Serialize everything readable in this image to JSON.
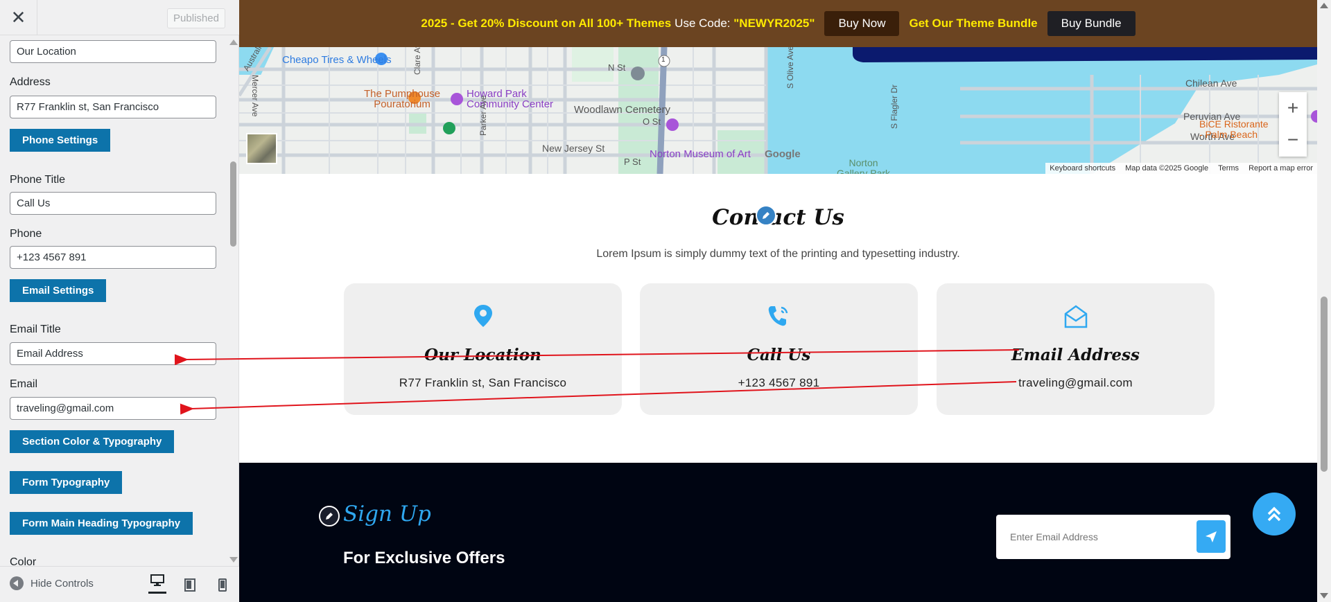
{
  "sidebar": {
    "close_label": "✕",
    "published_label": "Published",
    "fields": {
      "location_value": "Our Location",
      "address_label": "Address",
      "address_value": "R77 Franklin st, San Francisco",
      "phone_settings_btn": "Phone Settings",
      "phone_title_label": "Phone Title",
      "phone_title_value": "Call Us",
      "phone_label": "Phone",
      "phone_value": "+123 4567 891",
      "email_settings_btn": "Email Settings",
      "email_title_label": "Email Title",
      "email_title_value": "Email Address",
      "email_label": "Email",
      "email_value": "traveling@gmail.com",
      "section_color_btn": "Section Color & Typography",
      "form_typography_btn": "Form Typography",
      "form_heading_btn": "Form Main Heading Typography",
      "color_label": "Color"
    },
    "footer": {
      "hide_controls": "Hide Controls"
    }
  },
  "promo": {
    "text1": "2025 - Get 20% Discount on All 100+ Themes",
    "text2": "Use Code:",
    "code": "\"NEWYR2025\"",
    "buy_now": "Buy Now",
    "bundle_text": "Get Our Theme Bundle",
    "buy_bundle": "Buy Bundle"
  },
  "map": {
    "labels": {
      "cheapo": "Cheapo Tires & Wheels",
      "pumphouse": "The Pumphouse\nPouratorium",
      "howard": "Howard Park\nCommunity Center",
      "woodlawn": "Woodlawn Cemetery",
      "n_st": "N St",
      "o_st": "O St",
      "p_st": "P St",
      "new_jersey": "New Jersey St",
      "norton": "Norton Museum of Art",
      "norton_park": "Norton\nGallery Park",
      "chilean": "Chilean Ave",
      "peruvian": "Peruvian Ave",
      "worth": "Worth Ave",
      "bice": "BiCE Ristorante\n- Palm Beach",
      "clare": "Clare Ave",
      "parker": "Parker Ave",
      "mercer": "Mercer Ave",
      "olive": "S Olive Ave",
      "flagler": "S Flagler Dr",
      "australian": "Australian",
      "google": "Google",
      "route": "1"
    },
    "zoom_in": "+",
    "zoom_out": "−",
    "footer": [
      "Keyboard shortcuts",
      "Map data ©2025 Google",
      "Terms",
      "Report a map error"
    ]
  },
  "contact": {
    "title": "Contact Us",
    "subtitle": "Lorem Ipsum is simply dummy text of the printing and typesetting industry.",
    "cards": [
      {
        "title": "Our Location",
        "value": "R77 Franklin st, San Francisco",
        "icon": "location-pin-icon"
      },
      {
        "title": "Call Us",
        "value": "+123 4567 891",
        "icon": "phone-ringing-icon"
      },
      {
        "title": "Email Address",
        "value": "traveling@gmail.com",
        "icon": "envelope-open-icon"
      }
    ]
  },
  "signup": {
    "title": "Sign Up",
    "subtitle": "For Exclusive Offers",
    "placeholder": "Enter Email Address"
  },
  "colors": {
    "accent": "#0d73aa",
    "promo_bg": "#6b4421",
    "promo_yellow": "#ffea00",
    "signup_bg": "#000512",
    "signup_accent": "#35aaf3",
    "card_bg": "#efefef",
    "arrow": "#e0141c"
  }
}
